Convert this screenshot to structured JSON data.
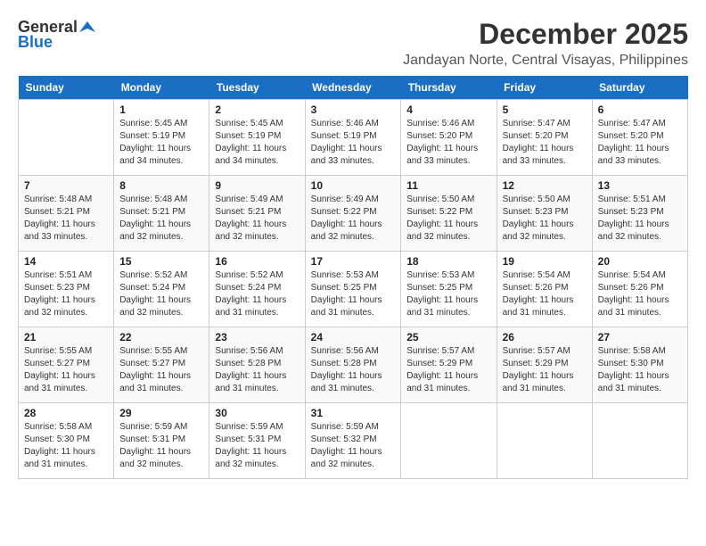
{
  "logo": {
    "general": "General",
    "blue": "Blue"
  },
  "title": {
    "month": "December 2025",
    "location": "Jandayan Norte, Central Visayas, Philippines"
  },
  "weekdays": [
    "Sunday",
    "Monday",
    "Tuesday",
    "Wednesday",
    "Thursday",
    "Friday",
    "Saturday"
  ],
  "weeks": [
    [
      {
        "day": "",
        "info": ""
      },
      {
        "day": "1",
        "info": "Sunrise: 5:45 AM\nSunset: 5:19 PM\nDaylight: 11 hours\nand 34 minutes."
      },
      {
        "day": "2",
        "info": "Sunrise: 5:45 AM\nSunset: 5:19 PM\nDaylight: 11 hours\nand 34 minutes."
      },
      {
        "day": "3",
        "info": "Sunrise: 5:46 AM\nSunset: 5:19 PM\nDaylight: 11 hours\nand 33 minutes."
      },
      {
        "day": "4",
        "info": "Sunrise: 5:46 AM\nSunset: 5:20 PM\nDaylight: 11 hours\nand 33 minutes."
      },
      {
        "day": "5",
        "info": "Sunrise: 5:47 AM\nSunset: 5:20 PM\nDaylight: 11 hours\nand 33 minutes."
      },
      {
        "day": "6",
        "info": "Sunrise: 5:47 AM\nSunset: 5:20 PM\nDaylight: 11 hours\nand 33 minutes."
      }
    ],
    [
      {
        "day": "7",
        "info": "Sunrise: 5:48 AM\nSunset: 5:21 PM\nDaylight: 11 hours\nand 33 minutes."
      },
      {
        "day": "8",
        "info": "Sunrise: 5:48 AM\nSunset: 5:21 PM\nDaylight: 11 hours\nand 32 minutes."
      },
      {
        "day": "9",
        "info": "Sunrise: 5:49 AM\nSunset: 5:21 PM\nDaylight: 11 hours\nand 32 minutes."
      },
      {
        "day": "10",
        "info": "Sunrise: 5:49 AM\nSunset: 5:22 PM\nDaylight: 11 hours\nand 32 minutes."
      },
      {
        "day": "11",
        "info": "Sunrise: 5:50 AM\nSunset: 5:22 PM\nDaylight: 11 hours\nand 32 minutes."
      },
      {
        "day": "12",
        "info": "Sunrise: 5:50 AM\nSunset: 5:23 PM\nDaylight: 11 hours\nand 32 minutes."
      },
      {
        "day": "13",
        "info": "Sunrise: 5:51 AM\nSunset: 5:23 PM\nDaylight: 11 hours\nand 32 minutes."
      }
    ],
    [
      {
        "day": "14",
        "info": "Sunrise: 5:51 AM\nSunset: 5:23 PM\nDaylight: 11 hours\nand 32 minutes."
      },
      {
        "day": "15",
        "info": "Sunrise: 5:52 AM\nSunset: 5:24 PM\nDaylight: 11 hours\nand 32 minutes."
      },
      {
        "day": "16",
        "info": "Sunrise: 5:52 AM\nSunset: 5:24 PM\nDaylight: 11 hours\nand 31 minutes."
      },
      {
        "day": "17",
        "info": "Sunrise: 5:53 AM\nSunset: 5:25 PM\nDaylight: 11 hours\nand 31 minutes."
      },
      {
        "day": "18",
        "info": "Sunrise: 5:53 AM\nSunset: 5:25 PM\nDaylight: 11 hours\nand 31 minutes."
      },
      {
        "day": "19",
        "info": "Sunrise: 5:54 AM\nSunset: 5:26 PM\nDaylight: 11 hours\nand 31 minutes."
      },
      {
        "day": "20",
        "info": "Sunrise: 5:54 AM\nSunset: 5:26 PM\nDaylight: 11 hours\nand 31 minutes."
      }
    ],
    [
      {
        "day": "21",
        "info": "Sunrise: 5:55 AM\nSunset: 5:27 PM\nDaylight: 11 hours\nand 31 minutes."
      },
      {
        "day": "22",
        "info": "Sunrise: 5:55 AM\nSunset: 5:27 PM\nDaylight: 11 hours\nand 31 minutes."
      },
      {
        "day": "23",
        "info": "Sunrise: 5:56 AM\nSunset: 5:28 PM\nDaylight: 11 hours\nand 31 minutes."
      },
      {
        "day": "24",
        "info": "Sunrise: 5:56 AM\nSunset: 5:28 PM\nDaylight: 11 hours\nand 31 minutes."
      },
      {
        "day": "25",
        "info": "Sunrise: 5:57 AM\nSunset: 5:29 PM\nDaylight: 11 hours\nand 31 minutes."
      },
      {
        "day": "26",
        "info": "Sunrise: 5:57 AM\nSunset: 5:29 PM\nDaylight: 11 hours\nand 31 minutes."
      },
      {
        "day": "27",
        "info": "Sunrise: 5:58 AM\nSunset: 5:30 PM\nDaylight: 11 hours\nand 31 minutes."
      }
    ],
    [
      {
        "day": "28",
        "info": "Sunrise: 5:58 AM\nSunset: 5:30 PM\nDaylight: 11 hours\nand 31 minutes."
      },
      {
        "day": "29",
        "info": "Sunrise: 5:59 AM\nSunset: 5:31 PM\nDaylight: 11 hours\nand 32 minutes."
      },
      {
        "day": "30",
        "info": "Sunrise: 5:59 AM\nSunset: 5:31 PM\nDaylight: 11 hours\nand 32 minutes."
      },
      {
        "day": "31",
        "info": "Sunrise: 5:59 AM\nSunset: 5:32 PM\nDaylight: 11 hours\nand 32 minutes."
      },
      {
        "day": "",
        "info": ""
      },
      {
        "day": "",
        "info": ""
      },
      {
        "day": "",
        "info": ""
      }
    ]
  ]
}
